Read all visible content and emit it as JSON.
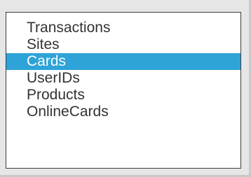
{
  "list": {
    "selected_index": 2,
    "selection_color": "#2da3d8",
    "items": [
      {
        "label": "Transactions"
      },
      {
        "label": "Sites"
      },
      {
        "label": "Cards"
      },
      {
        "label": "UserIDs"
      },
      {
        "label": "Products"
      },
      {
        "label": "OnlineCards"
      }
    ]
  }
}
